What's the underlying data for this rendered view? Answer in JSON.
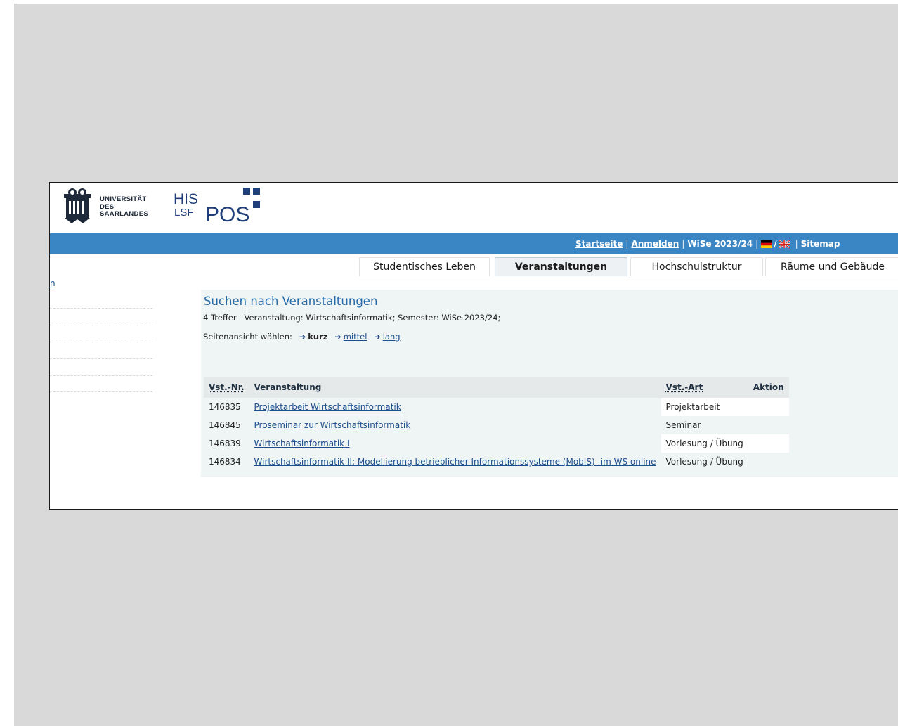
{
  "header": {
    "uni_name_lines": [
      "UNIVERSITÄT",
      "DES",
      "SAARLANDES"
    ],
    "system_logo": {
      "his": "HIS",
      "lsf": "LSF",
      "pos": "POS"
    }
  },
  "topbar": {
    "start": "Startseite",
    "login": "Anmelden",
    "semester": "WiSe 2023/24",
    "lang_sep": "/",
    "sitemap": "Sitemap",
    "bar_color": "#3a86c4"
  },
  "tabs": [
    {
      "label": "Studentisches Leben",
      "active": false
    },
    {
      "label": "Veranstaltungen",
      "active": true
    },
    {
      "label": "Hochschulstruktur",
      "active": false
    },
    {
      "label": "Räume und Gebäude",
      "active": false
    }
  ],
  "left_nav": {
    "link_fragment": "n"
  },
  "main": {
    "title": "Suchen nach Veranstaltungen",
    "hits": "4 Treffer   Veranstaltung: Wirtschaftsinformatik; Semester: WiSe 2023/24;",
    "view_label": "Seitenansicht wählen:",
    "view_options": {
      "short": "kurz",
      "medium": "mittel",
      "long": "lang"
    },
    "table": {
      "headers": {
        "nr": "Vst.-Nr.",
        "title": "Veranstaltung",
        "type": "Vst.-Art",
        "action": "Aktion"
      },
      "rows": [
        {
          "nr": "146835",
          "title": "Projektarbeit Wirtschaftsinformatik",
          "type": "Projektarbeit"
        },
        {
          "nr": "146845",
          "title": "Proseminar zur Wirtschaftsinformatik",
          "type": "Seminar"
        },
        {
          "nr": "146839",
          "title": "Wirtschaftsinformatik I",
          "type": "Vorlesung / Übung"
        },
        {
          "nr": "146834",
          "title": "Wirtschaftsinformatik II: Modellierung betrieblicher Informationssysteme (MobIS) -im WS online",
          "type": "Vorlesung / Übung"
        }
      ]
    }
  }
}
